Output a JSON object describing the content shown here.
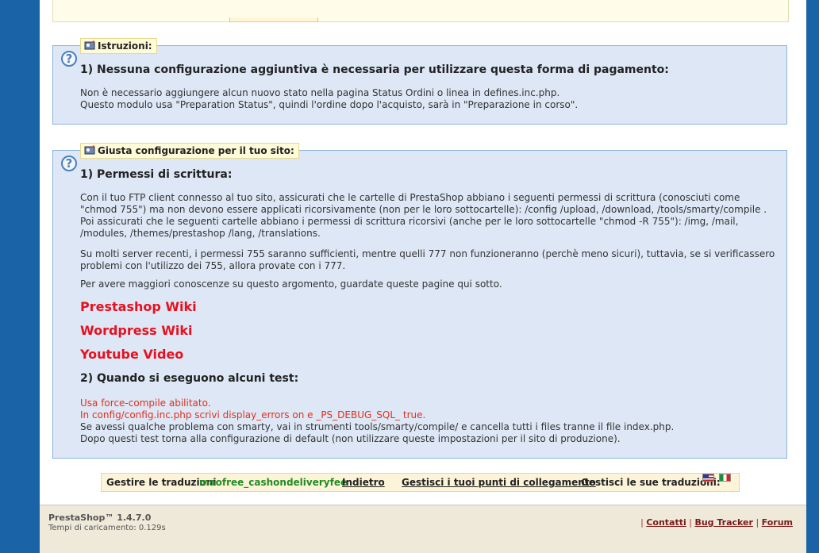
{
  "instructions": {
    "legend": "Istruzioni:",
    "heading": "1) Nessuna configurazione aggiuntiva è necessaria per utilizzare questa forma di pagamento:",
    "line1": "Non è necessario aggiungere alcun nuovo stato nella pagina Status Ordini o linea in defines.inc.php.",
    "line2": "Questo modulo usa \"Preparation Status\", quindi l'ordine dopo l'acquisto, sarà in \"Preparazione in corso\"."
  },
  "config": {
    "legend": "Giusta configurazione per il tuo sito:",
    "heading1": "1) Permessi di scrittura:",
    "para1": "Con il tuo FTP client connesso al tuo sito, assicurati che le cartelle di PrestaShop abbiano i seguenti permessi di scrittura (conosciuti come \"chmod 755\") ma non devono essere applicati ricorsivamente (non per le loro sottocartelle): /config /upload, /download, /tools/smarty/compile . Poi assicurati che le seguenti cartelle abbiano i permessi di scrittura ricorsivi (anche per le loro sottocartelle \"chmod -R 755\"): /img, /mail, /modules, /themes/prestashop /lang, /translations.",
    "para2": "Su molti server recenti, i permessi 755 saranno sufficienti, mentre quelli 777 non funzioneranno (perchè meno sicuri), tuttavia, se si verificassero problemi con l'utilizzo dei 755, allora provate con i 777.",
    "para3": "Per avere maggiori conoscenze su questo argomento, guardate queste pagine qui sotto.",
    "links": [
      "Prestashop Wiki",
      "Wordpress Wiki",
      "Youtube Video"
    ],
    "heading2": "2) Quando si eseguono alcuni test:",
    "test_red1": "Usa force-compile abilitato.",
    "test_red2": "In config/config.inc.php scrivi display_errors on e _PS_DEBUG_SQL_ true.",
    "test3": "Se avessi qualche problema con smarty, vai in strumenti tools/smarty/compile/ e cancella tutti i files tranne il file index.php.",
    "test4": "Dopo questi test torna alla configurazione di default (non utilizzare queste impostazioni per il sito di produzione)."
  },
  "translations_bar": {
    "manage_label": "Gestire le traduzioni",
    "module_name": "maofree_cashondeliveryfee",
    "back": "Indietro",
    "hooks": "Gestisci i tuoi punti di collegamento",
    "manage_its": "Gestisci le sue traduzioni:"
  },
  "footer": {
    "version": "PrestaShop™ 1.4.7.0",
    "load_time": "Tempi di caricamento: 0.129s",
    "links": [
      "Contatti",
      "Bug Tracker",
      "Forum"
    ]
  },
  "colors": {
    "background": "#1a63a6",
    "panel": "#dde7f5",
    "link_red": "#e8101e",
    "module_green": "#228b22"
  }
}
